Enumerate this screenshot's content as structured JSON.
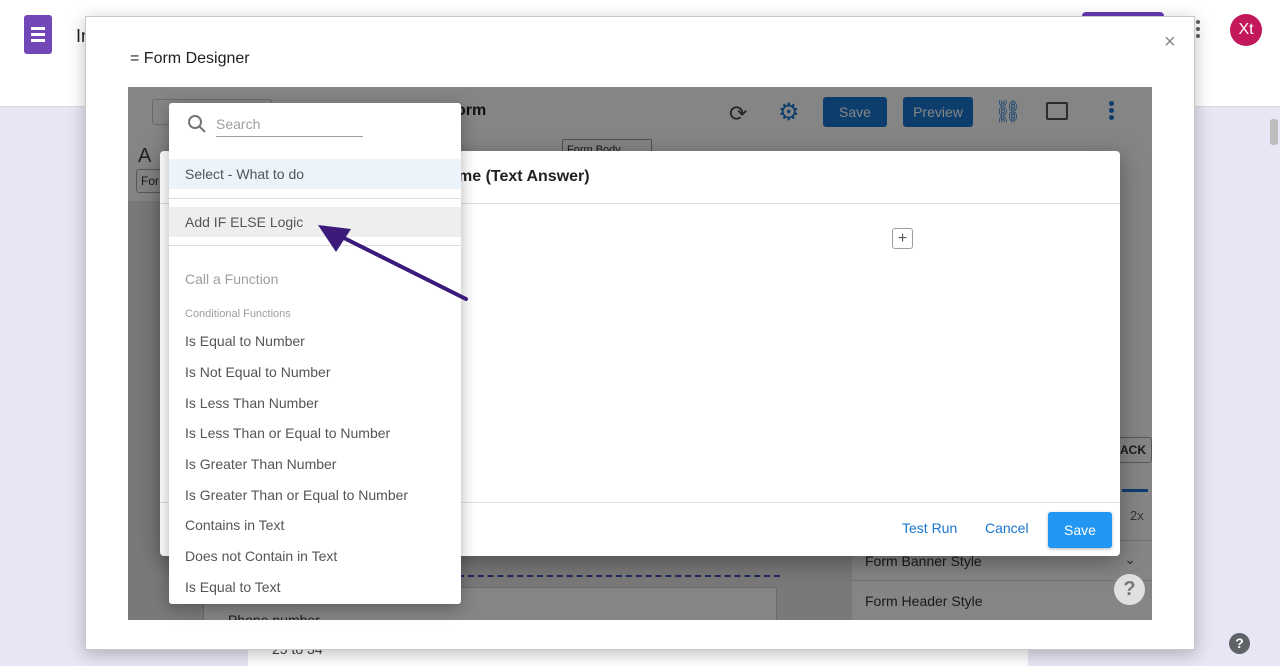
{
  "page": {
    "app_title_partial": "In",
    "avatar_initials": "Xt",
    "bottom_text": "25 to 34"
  },
  "designer": {
    "title": "= Form Designer",
    "close_label": "×"
  },
  "canvas": {
    "form_name": "orm",
    "toolbar": {
      "save_label": "Save",
      "preview_label": "Preview",
      "form_body_label": "Form Body",
      "chip_label": "For"
    },
    "right_panel": {
      "back_label": "ACK",
      "speed_label": "2x",
      "rows": [
        "",
        "",
        "Form Banner Style",
        "Form Header Style"
      ]
    },
    "phone_label": "Phone number",
    "help_label": "?"
  },
  "dialog": {
    "title": "me (Text Answer)",
    "add_label": "+",
    "test_run_label": "Test Run",
    "cancel_label": "Cancel",
    "save_label": "Save"
  },
  "dropdown": {
    "search_placeholder": "Search",
    "search_value": "",
    "selected_item": "Select - What to do",
    "hover_item": "Add IF ELSE Logic",
    "call_function_header": "Call a Function",
    "conditional_header": "Conditional Functions",
    "functions": [
      "Is Equal to Number",
      "Is Not Equal to Number",
      "Is Less Than Number",
      "Is Less Than or Equal to Number",
      "Is Greater Than Number",
      "Is Greater Than or Equal to Number",
      "Contains in Text",
      "Does not Contain in Text",
      "Is Equal to Text"
    ]
  },
  "help_label": "?",
  "colors": {
    "accent_blue": "#1976d2",
    "save_blue": "#2196f3",
    "forms_purple": "#7248b9",
    "arrow": "#3b1a7a",
    "avatar": "#c2185b"
  }
}
